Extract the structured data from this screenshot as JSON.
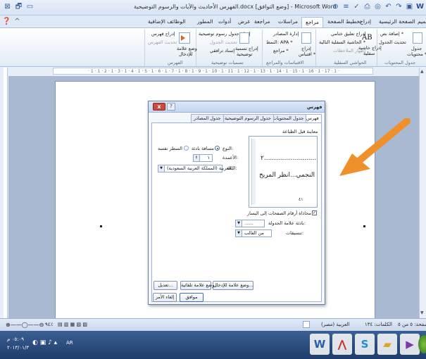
{
  "titlebar": {
    "title": "الفهرس الأحاديث والآيات والرسوم التوضيحية.docx [وضع التوافق] - Microsoft Word"
  },
  "tabs": [
    {
      "label": "تصميم"
    },
    {
      "label": "الصفحة الرئيسية"
    },
    {
      "label": "إدراج"
    },
    {
      "label": "تخطيط الصفحة"
    },
    {
      "label": "مراجع"
    },
    {
      "label": "مراسلات"
    },
    {
      "label": "مراجعة"
    },
    {
      "label": "عرض"
    },
    {
      "label": "أدوات"
    },
    {
      "label": "المطور"
    },
    {
      "label": "الوظائف الإضافية"
    }
  ],
  "ribbon": {
    "toc": {
      "label1": "جدول",
      "label2": "محتويات *",
      "add_text": "إضافة نص *",
      "update": "تحديث الجدول",
      "group": "جدول المحتويات"
    },
    "footnotes": {
      "insert_endnote": "إدراج تعليق ختامي",
      "next": "الحاشية السفلية التالية *",
      "show": "إظهار الملاحظات",
      "insert_fn1": "إدراج حاشية",
      "insert_fn2": "سفلية",
      "ab": "AB",
      "group": "الحواشي السفلية"
    },
    "citations": {
      "manage": "إدارة المصادر",
      "style": "النمط: APA *",
      "bib": "مراجع *",
      "insert1": "إدراج",
      "insert2": "اقتباس *",
      "group": "الاقتباسات والمراجع"
    },
    "captions": {
      "table_figures": "إدراج جدول رسوم توضيحية",
      "update": "تحديث الجدول",
      "cross": "إسناد ترافقي",
      "insert_caption1": "إدراج تسمية",
      "insert_caption2": "توضيحية",
      "group": "تسميات توضيحية"
    },
    "index": {
      "insert": "إدراج فهرس",
      "update": "تحديث الفهرس",
      "mark1": "وضع علامة",
      "mark2": "للإدخال",
      "group": "الفهرس"
    }
  },
  "ruler": {
    "text": "· 1 · 1 · 2 · 1 · 3 · 1 · 4 · 1 · 5 · 1 · 6 · 1 · 7 · 1 · 8 · 1 · 9 · 1 · 10 · 1 · 11 · 1 · 12 · 1 · 13 · 1 · 14 · 1 · 15 · 1 · 16 · 1 · 17 · 1 ·"
  },
  "dialog": {
    "title": "فهرس",
    "close": "x",
    "help": "?",
    "tabs": [
      "فهرس",
      "جدول المحتويات",
      "جدول الرسوم التوضيحية",
      "جدول المصادر"
    ],
    "print_preview_label": "معاينة قبل الطباعة",
    "preview_line1": "٢..........................",
    "preview_line2": "النجمي...انظر المريخ",
    "preview_line3": "٤١",
    "type_label": "النوع:",
    "type_opt1": "مسافة بادئة",
    "type_opt2": "السطر نفسه",
    "columns_label": "الأعمدة:",
    "columns_value": "١",
    "language_label": "اللغة:",
    "language_value": "العربية (المملكة العربية السعودية)",
    "right_align": "محاذاة أرقام الصفحات إلى اليسار",
    "leader_label": "بادئة علامة الجدولة:",
    "leader_value": "......",
    "formats_label": "تنسيقات:",
    "formats_value": "من القالب",
    "btn_mark_entry": "وضع علامة للإدخال...",
    "btn_automark": "وضع علامة تلقائية...",
    "btn_modify": "تعديل...",
    "btn_ok": "موافق",
    "btn_cancel": "إلغاء الأمر"
  },
  "statusbar": {
    "page": "صفحة: ٥ من ٥",
    "words": "الكلمات: ١٣٤",
    "lang": "العربية (مصر)",
    "zoom": "٩٤٪"
  },
  "taskbar": {
    "time": "٠٥:٠٩ م",
    "date": "٢٠١٣/٠١/٣",
    "ar": "AR"
  },
  "colors": {
    "accent": "#f0902a",
    "close": "#c94a3f"
  }
}
